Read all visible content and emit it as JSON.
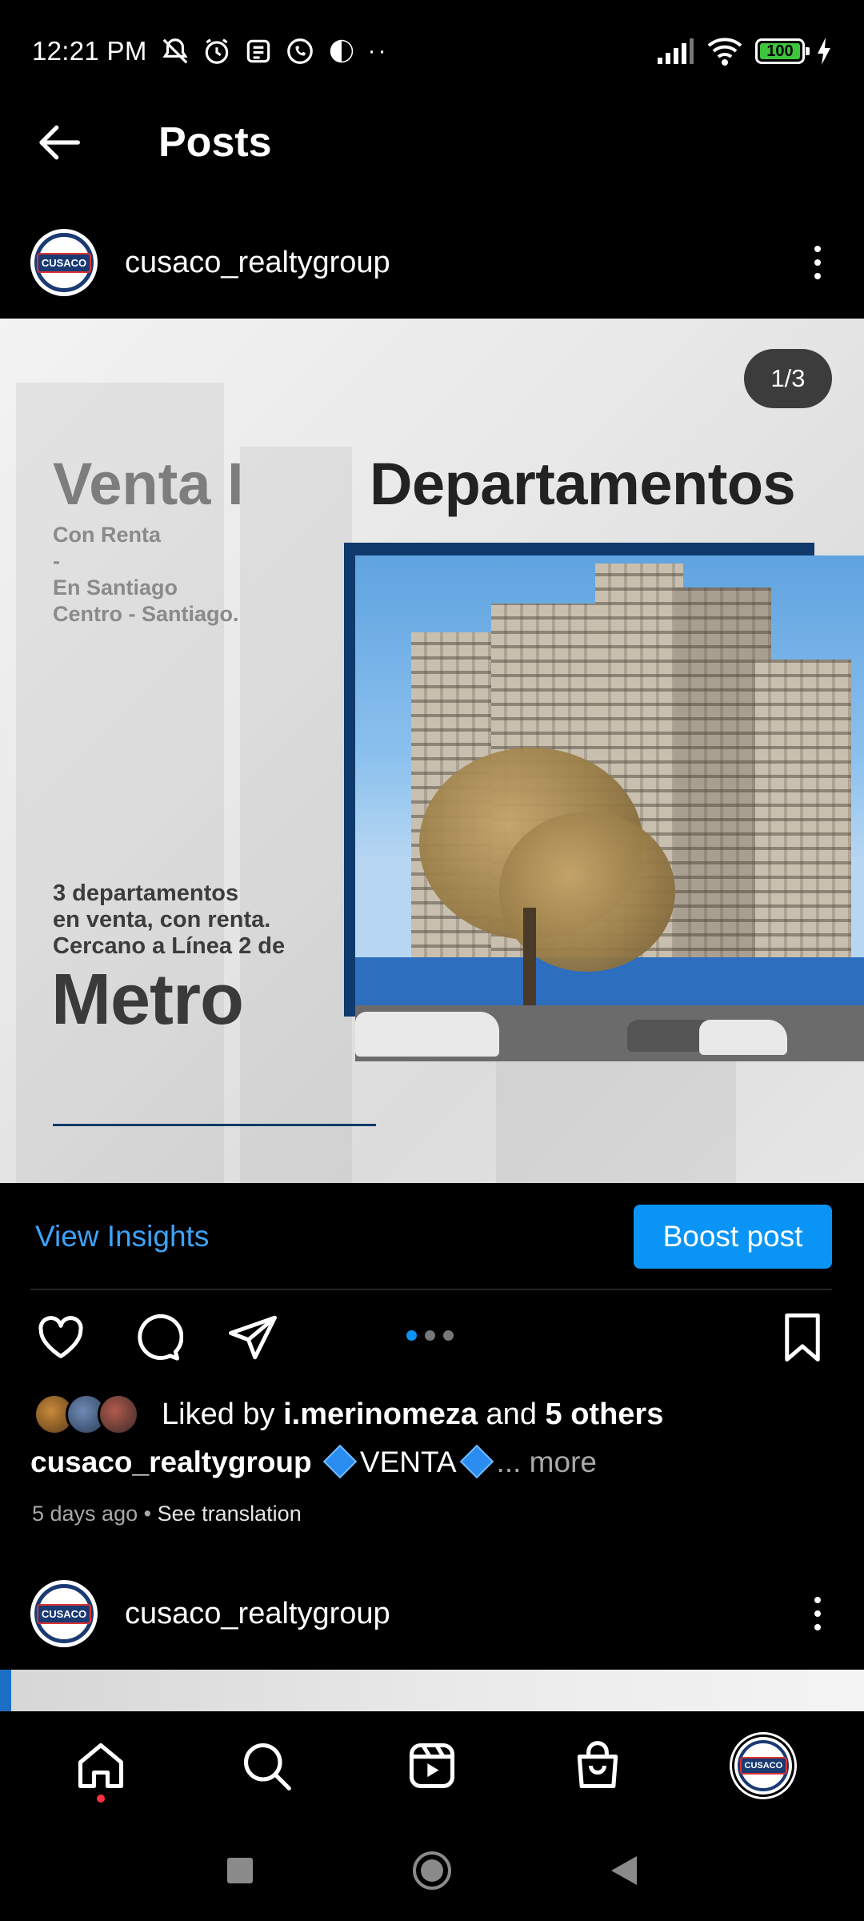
{
  "status_bar": {
    "time": "12:21 PM",
    "dots": "··",
    "battery": "100"
  },
  "app_bar": {
    "title": "Posts"
  },
  "post": {
    "username": "cusaco_realtygroup",
    "counter": "1/3",
    "image_text": {
      "venta": "Venta I",
      "departamentos": "Departamentos",
      "con_renta": "Con Renta",
      "dash": "-",
      "en_santiago": "En Santiago",
      "centro": "Centro - Santiago.",
      "promo_line1": "3 departamentos",
      "promo_line2": "en venta, con renta.",
      "promo_line3": "Cercano a Línea 2 de",
      "metro": "Metro"
    },
    "view_insights": "View Insights",
    "boost_post": "Boost post",
    "carousel": {
      "total": 3,
      "active": 1
    },
    "likes": {
      "prefix": "Liked by",
      "user": "i.merinomeza",
      "and": "and",
      "others": "5 others"
    },
    "caption": {
      "username": "cusaco_realtygroup",
      "text": "VENTA",
      "ellipsis": "...",
      "more": "more"
    },
    "time_ago": "5 days ago",
    "separator": "•",
    "see_translation": "See translation"
  },
  "next_post": {
    "username": "cusaco_realtygroup"
  },
  "avatar_logo": "CUSACO",
  "colors": {
    "accent_blue": "#0a95f6",
    "link_blue": "#3ea2f8",
    "brand_navy": "#0f3a6b",
    "notification_red": "#ff3040"
  }
}
